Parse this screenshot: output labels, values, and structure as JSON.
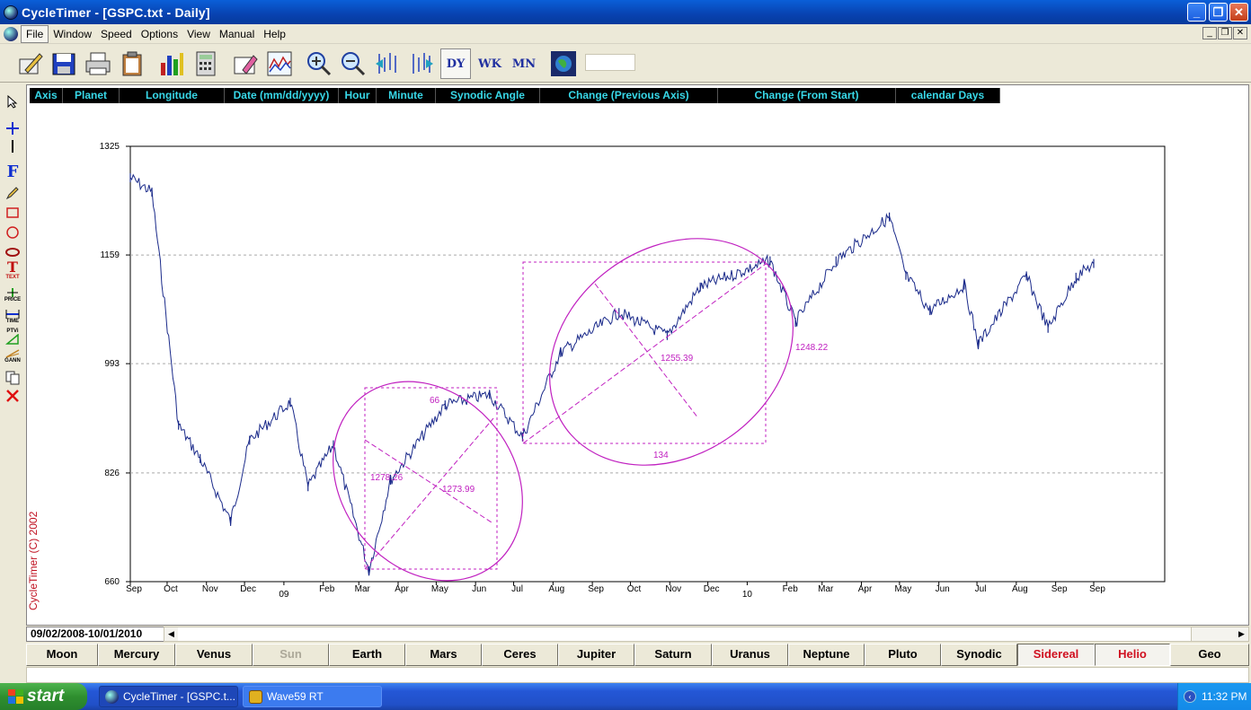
{
  "window": {
    "title": "CycleTimer - [GSPC.txt - Daily]"
  },
  "menu": {
    "items": [
      "File",
      "Window",
      "Speed",
      "Options",
      "View",
      "Manual",
      "Help"
    ]
  },
  "toolbar": {
    "icons": [
      "edit-icon",
      "save-icon",
      "print-icon",
      "clipboard-icon",
      "bar-chart-icon",
      "calculator-icon",
      "eraser-icon",
      "wave-chart-icon",
      "zoom-in-icon",
      "zoom-out-icon",
      "scroll-left-icon",
      "scroll-right-icon",
      "daily-icon",
      "weekly-icon",
      "monthly-icon",
      "globe-icon"
    ],
    "dy_label": "DY",
    "wk_label": "WK",
    "mn_label": "MN"
  },
  "header_columns": [
    "Axis",
    "Planet",
    "Longitude",
    "Date  (mm/dd/yyyy)",
    "Hour",
    "Minute",
    "Synodic Angle",
    "Change (Previous Axis)",
    "Change (From Start)",
    "calendar Days"
  ],
  "left_tools": {
    "f_label": "F",
    "text_label": "TEXT",
    "price_label": "PRICE",
    "time_label": "TIME",
    "ptvi_label": "PTVi",
    "gann_label": "GANN"
  },
  "chart_data": {
    "type": "line",
    "series_name": "GSPC",
    "ylim": [
      660,
      1325
    ],
    "yticks": [
      660,
      826,
      993,
      1159,
      1325
    ],
    "xticks": [
      "Sep",
      "Oct",
      "Nov",
      "Dec",
      "Feb",
      "Mar",
      "Apr",
      "May",
      "Jun",
      "Jul",
      "Aug",
      "Sep",
      "Oct",
      "Nov",
      "Dec",
      "Feb",
      "Mar",
      "Apr",
      "May",
      "Jun",
      "Jul",
      "Aug",
      "Sep",
      "Sep"
    ],
    "year_labels": [
      "09",
      "10"
    ],
    "grid": "horizontal dashed",
    "x": [
      "2008-09-02",
      "2008-09-19",
      "2008-10-10",
      "2008-10-27",
      "2008-11-20",
      "2008-12-05",
      "2009-01-06",
      "2009-01-20",
      "2009-02-09",
      "2009-03-09",
      "2009-03-26",
      "2009-05-08",
      "2009-06-12",
      "2009-07-08",
      "2009-08-07",
      "2009-09-22",
      "2009-10-30",
      "2009-11-25",
      "2010-01-19",
      "2010-02-08",
      "2010-03-12",
      "2010-04-23",
      "2010-05-06",
      "2010-05-25",
      "2010-06-21",
      "2010-07-02",
      "2010-08-09",
      "2010-08-26",
      "2010-09-17",
      "2010-10-01"
    ],
    "values": [
      1277,
      1255,
      899,
      848,
      752,
      876,
      934,
      805,
      869,
      677,
      815,
      930,
      946,
      881,
      1010,
      1071,
      1036,
      1110,
      1150,
      1056,
      1150,
      1217,
      1128,
      1074,
      1113,
      1023,
      1127,
      1047,
      1125,
      1146
    ],
    "annotations": [
      {
        "text": "66"
      },
      {
        "text": "1273.99"
      },
      {
        "text": "1278.26"
      },
      {
        "text": "1255.39"
      },
      {
        "text": "134"
      },
      {
        "text": "1248.22"
      }
    ]
  },
  "copyright": "CycleTimer (C) 2002",
  "date_range": "09/02/2008-10/01/2010",
  "planet_buttons": [
    "Moon",
    "Mercury",
    "Venus",
    "Sun",
    "Earth",
    "Mars",
    "Ceres",
    "Jupiter",
    "Saturn",
    "Uranus",
    "Neptune",
    "Pluto",
    "Synodic",
    "Sidereal",
    "Helio",
    "Geo"
  ],
  "taskbar": {
    "start_label": "start",
    "tasks": [
      "CycleTimer - [GSPC.t...",
      "Wave59 RT"
    ],
    "clock": "11:32 PM"
  },
  "colors": {
    "price_line": "#1a2a8a",
    "annotation": "#c020c0",
    "header_text": "#38d8e8",
    "copyright": "#c01020"
  }
}
